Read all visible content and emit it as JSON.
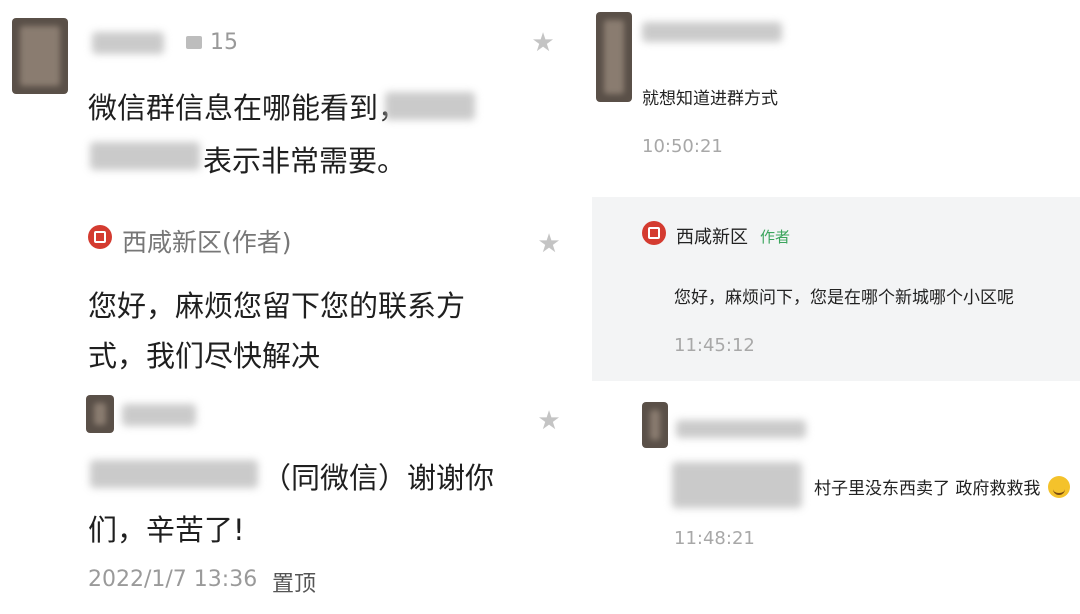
{
  "left": {
    "comment1": {
      "like_count": "15",
      "text_line1": "微信群信息在哪能看到，",
      "text_line2": "表示非常需要。"
    },
    "reply": {
      "author": "西咸新区(作者)",
      "text_line1": "您好，麻烦您留下您的联系方",
      "text_line2": "式，我们尽快解决"
    },
    "comment2": {
      "text_line1": "（同微信）谢谢你",
      "text_line2": "们，辛苦了!",
      "timestamp": "2022/1/7 13:36",
      "pin_label": "置顶"
    }
  },
  "right": {
    "comment1": {
      "text": "就想知道进群方式",
      "time": "10:50:21"
    },
    "reply": {
      "author": "西咸新区",
      "tag": "作者",
      "text": "您好，麻烦问下，您是在哪个新城哪个小区呢",
      "time": "11:45:12"
    },
    "comment2": {
      "text": "村子里没东西卖了  政府救救我",
      "time": "11:48:21"
    }
  }
}
